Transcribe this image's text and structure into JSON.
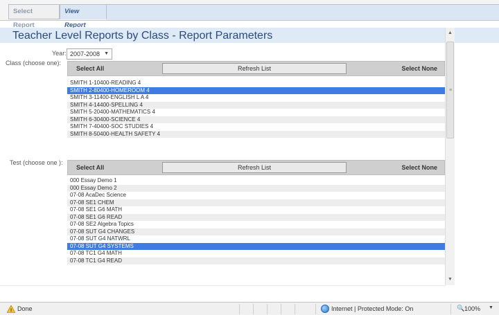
{
  "tabs": {
    "select_report": "Select Report",
    "view_report": "View Report"
  },
  "page": {
    "title": "Teacher Level Reports by Class - Report Parameters"
  },
  "year": {
    "label": "Year:",
    "value": "2007-2008"
  },
  "class_section": {
    "label": "Class (choose one):",
    "select_all": "Select All",
    "refresh": "Refresh List",
    "select_none": "Select None",
    "items": [
      {
        "label": "SMITH 1-10400-READING 4",
        "selected": false
      },
      {
        "label": "SMITH 2-80400-HOMEROOM 4",
        "selected": true
      },
      {
        "label": "SMITH 3-11400-ENGLISH L A 4",
        "selected": false
      },
      {
        "label": "SMITH 4-14400-SPELLING 4",
        "selected": false
      },
      {
        "label": "SMITH 5-20400-MATHEMATICS 4",
        "selected": false
      },
      {
        "label": "SMITH 6-30400-SCIENCE 4",
        "selected": false
      },
      {
        "label": "SMITH 7-40400-SOC STUDIES 4",
        "selected": false
      },
      {
        "label": "SMITH 8-50400-HEALTH SAFETY 4",
        "selected": false
      }
    ]
  },
  "test_section": {
    "label": "Test (choose one ):",
    "select_all": "Select All",
    "refresh": "Refresh List",
    "select_none": "Select None",
    "items": [
      {
        "label": "000 Essay Demo 1",
        "selected": false
      },
      {
        "label": "000 Essay Demo 2",
        "selected": false
      },
      {
        "label": "07-08 AcaDec Science",
        "selected": false
      },
      {
        "label": "07-08 SE1 CHEM",
        "selected": false
      },
      {
        "label": "07-08 SE1 G6 MATH",
        "selected": false
      },
      {
        "label": "07-08 SE1 G6 READ",
        "selected": false
      },
      {
        "label": "07-08 SE2 Algebra Topics",
        "selected": false
      },
      {
        "label": "07-08 SUT G4 CHANGES",
        "selected": false
      },
      {
        "label": "07-08 SUT G4 NATWRL",
        "selected": false
      },
      {
        "label": "07-08 SUT G4 SYSTEMS",
        "selected": true
      },
      {
        "label": "07-08 TC1 G4 MATH",
        "selected": false
      },
      {
        "label": "07-08 TC1 G4 READ",
        "selected": false
      }
    ]
  },
  "statusbar": {
    "done": "Done",
    "zone": "Internet | Protected Mode: On",
    "zoom": "100%"
  },
  "icons": {
    "warning": "warning-icon",
    "globe": "globe-icon",
    "zoom": "zoom-icon"
  },
  "colors": {
    "selection": "#3f7be3",
    "title": "#2c4a7e",
    "title_band": "#dfeaf7"
  }
}
